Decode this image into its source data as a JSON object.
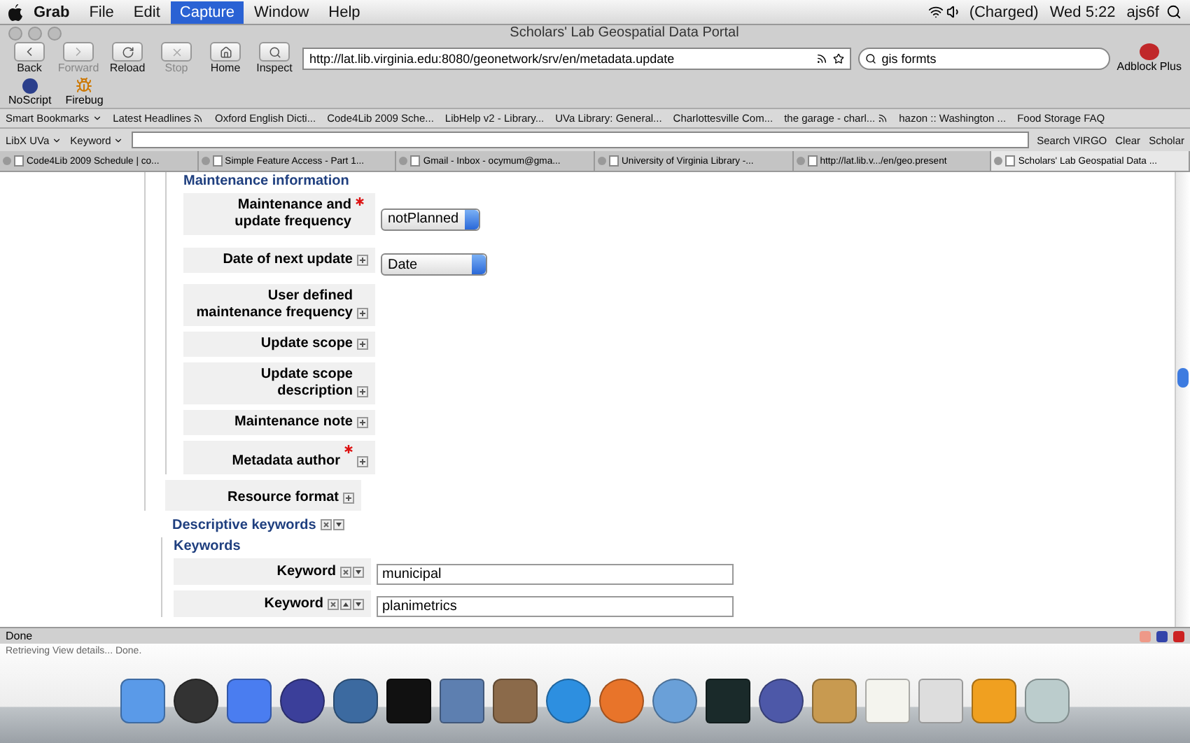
{
  "menu_bar": {
    "items": [
      {
        "label": "Grab",
        "selected": false,
        "app": true
      },
      {
        "label": "File",
        "selected": false,
        "app": false
      },
      {
        "label": "Edit",
        "selected": false,
        "app": false
      },
      {
        "label": "Capture",
        "selected": true,
        "app": false
      },
      {
        "label": "Window",
        "selected": false,
        "app": false
      },
      {
        "label": "Help",
        "selected": false,
        "app": false
      }
    ],
    "battery": "(Charged)",
    "clock": "Wed 5:22",
    "user": "ajs6f"
  },
  "window": {
    "title": "Scholars' Lab Geospatial Data Portal"
  },
  "nav_buttons": [
    {
      "kind": "back",
      "label": "Back",
      "disabled": false
    },
    {
      "kind": "forward",
      "label": "Forward",
      "disabled": true
    },
    {
      "kind": "reload",
      "label": "Reload",
      "disabled": false
    },
    {
      "kind": "stop",
      "label": "Stop",
      "disabled": true
    },
    {
      "kind": "home",
      "label": "Home",
      "disabled": false
    },
    {
      "kind": "inspect",
      "label": "Inspect",
      "disabled": false
    }
  ],
  "address": {
    "value": "http://lat.lib.virginia.edu:8080/geonetwork/srv/en/metadata.update"
  },
  "search": {
    "value": "gis formts"
  },
  "adblock": {
    "label": "Adblock Plus"
  },
  "addons": [
    {
      "kind": "noscript",
      "label": "NoScript"
    },
    {
      "kind": "firebug",
      "label": "Firebug"
    }
  ],
  "bookmarks": [
    {
      "label": "Smart Bookmarks",
      "menu": true,
      "feed": false
    },
    {
      "label": "Latest Headlines",
      "menu": false,
      "feed": true
    },
    {
      "label": "Oxford English Dicti...",
      "menu": false,
      "feed": false
    },
    {
      "label": "Code4Lib 2009 Sche...",
      "menu": false,
      "feed": false
    },
    {
      "label": "LibHelp v2 - Library...",
      "menu": false,
      "feed": false
    },
    {
      "label": "UVa Library: General...",
      "menu": false,
      "feed": false
    },
    {
      "label": "Charlottesville Com...",
      "menu": false,
      "feed": false
    },
    {
      "label": "the garage - charl...",
      "menu": false,
      "feed": true
    },
    {
      "label": "hazon :: Washington ...",
      "menu": false,
      "feed": false
    },
    {
      "label": "Food Storage FAQ",
      "menu": false,
      "feed": false
    }
  ],
  "libx": {
    "label": "LibX UVa",
    "search_type": "Keyword",
    "search_button": "Search VIRGO",
    "clear": "Clear",
    "scholar": "Scholar"
  },
  "tabs": [
    {
      "label": "Code4Lib 2009 Schedule | co...",
      "selected": false
    },
    {
      "label": "Simple Feature Access - Part 1...",
      "selected": false
    },
    {
      "label": "Gmail - Inbox - ocymum@gma...",
      "selected": false
    },
    {
      "label": "University of Virginia Library -...",
      "selected": false
    },
    {
      "label": "http://lat.lib.v.../en/geo.present",
      "selected": false
    },
    {
      "label": "Scholars' Lab Geospatial Data ...",
      "selected": true
    }
  ],
  "form": {
    "section": "Maintenance information",
    "rows": [
      {
        "label": "Maintenance and update frequency",
        "required": true,
        "actions": [],
        "kind": "select",
        "value": "notPlanned"
      },
      {
        "label": "Date of next update",
        "required": false,
        "actions": [
          {
            "kind": "expand"
          }
        ],
        "kind": "select",
        "value": "Date"
      },
      {
        "label": "User defined maintenance frequency",
        "required": false,
        "actions": [
          {
            "kind": "expand"
          }
        ],
        "kind": "empty"
      },
      {
        "label": "Update scope",
        "required": false,
        "actions": [
          {
            "kind": "expand"
          }
        ],
        "kind": "empty"
      },
      {
        "label": "Update scope description",
        "required": false,
        "actions": [
          {
            "kind": "expand"
          }
        ],
        "kind": "empty"
      },
      {
        "label": "Maintenance note",
        "required": false,
        "actions": [
          {
            "kind": "expand"
          }
        ],
        "kind": "empty"
      },
      {
        "label": "Metadata author",
        "required": true,
        "actions": [
          {
            "kind": "expand"
          }
        ],
        "kind": "empty"
      }
    ],
    "resource_format": {
      "label": "Resource format",
      "actions": [
        {
          "kind": "expand"
        }
      ]
    },
    "keywords_section": {
      "label": "Descriptive keywords",
      "actions": [
        {
          "kind": "remove"
        },
        {
          "kind": "down"
        }
      ]
    },
    "keywords_group": "Keywords",
    "keywords": [
      {
        "label": "Keyword",
        "actions": [
          {
            "kind": "remove"
          },
          {
            "kind": "down"
          }
        ],
        "value": "municipal"
      },
      {
        "label": "Keyword",
        "actions": [
          {
            "kind": "remove"
          },
          {
            "kind": "up"
          },
          {
            "kind": "down"
          }
        ],
        "value": "planimetrics"
      }
    ]
  },
  "status_bar": {
    "text": "Done"
  },
  "dock": {
    "status": "Retrieving View details... Done."
  }
}
